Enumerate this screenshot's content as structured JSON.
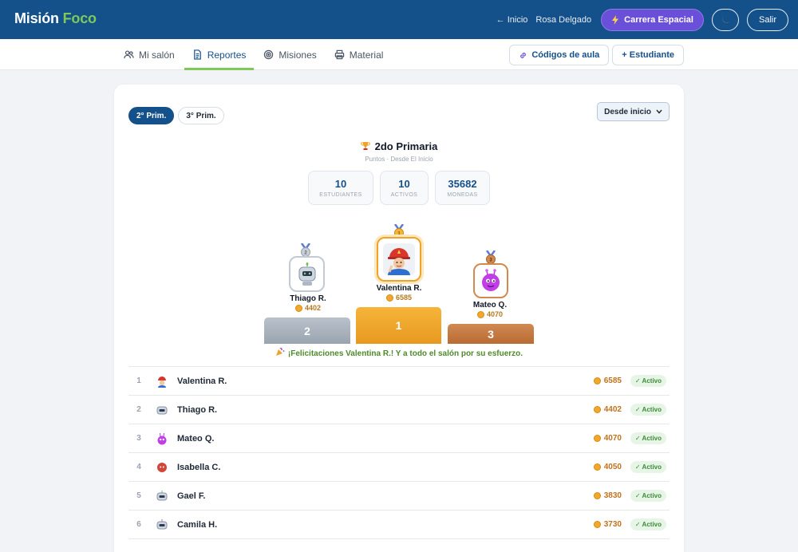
{
  "app": {
    "brand_part1": "Misión",
    "brand_part2": "Foco"
  },
  "header": {
    "home_link": "← Inicio",
    "user": "Rosa Delgado",
    "space_button": "Carrera Espacial",
    "exit_button": "Salir"
  },
  "nav": {
    "tabs": [
      {
        "label": "Mi salón",
        "icon": "users-icon"
      },
      {
        "label": "Reportes",
        "icon": "document-icon",
        "active": true
      },
      {
        "label": "Misiones",
        "icon": "target-icon"
      },
      {
        "label": "Material",
        "icon": "printer-icon"
      }
    ],
    "codes_button": "Códigos de aula",
    "add_student_button": "+ Estudiante"
  },
  "filters": {
    "grades": [
      "2° Prim.",
      "3° Prim."
    ],
    "active_grade": "2° Prim.",
    "range_selected": "Desde inicio"
  },
  "summary": {
    "title": "2do Primaria",
    "subtitle": "Puntos · Desde El Inicio",
    "stats": [
      {
        "value": "10",
        "label": "ESTUDIANTES"
      },
      {
        "value": "10",
        "label": "ACTIVOS"
      },
      {
        "value": "35682",
        "label": "MONEDAS"
      }
    ]
  },
  "podium": {
    "first": {
      "name": "Valentina R.",
      "coins": "6585",
      "place": "1"
    },
    "second": {
      "name": "Thiago R.",
      "coins": "4402",
      "place": "2"
    },
    "third": {
      "name": "Mateo Q.",
      "coins": "4070",
      "place": "3"
    },
    "congrats": "¡Felicitaciones Valentina R.! Y a todo el salón por su esfuerzo."
  },
  "ranking": [
    {
      "pos": "1",
      "name": "Valentina R.",
      "coins": "6585",
      "status": "✓ Activo",
      "avatar": "firefighter"
    },
    {
      "pos": "2",
      "name": "Thiago R.",
      "coins": "4402",
      "status": "✓ Activo",
      "avatar": "robot"
    },
    {
      "pos": "3",
      "name": "Mateo Q.",
      "coins": "4070",
      "status": "✓ Activo",
      "avatar": "alien-purple"
    },
    {
      "pos": "4",
      "name": "Isabella C.",
      "coins": "4050",
      "status": "✓ Activo",
      "avatar": "red-blob"
    },
    {
      "pos": "5",
      "name": "Gael F.",
      "coins": "3830",
      "status": "✓ Activo",
      "avatar": "robot-green"
    },
    {
      "pos": "6",
      "name": "Camila H.",
      "coins": "3730",
      "status": "✓ Activo",
      "avatar": "robot-pink"
    }
  ],
  "colors": {
    "header": "#14508a",
    "accent_green": "#7ccb5a",
    "space_purple": "#6a4fd8",
    "gold": "#f0a32a",
    "silver": "#a9b2bd",
    "bronze": "#c97b44"
  }
}
